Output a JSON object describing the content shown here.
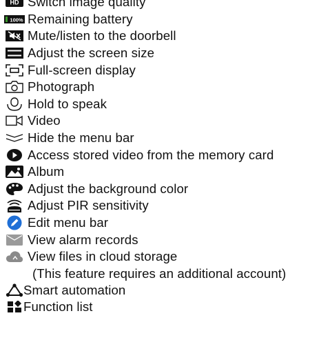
{
  "legend": {
    "items": [
      {
        "icon": "hd-icon",
        "label": "Switch image quality"
      },
      {
        "icon": "battery-icon",
        "badge": "100%",
        "label": "Remaining battery"
      },
      {
        "icon": "mute-icon",
        "label": "Mute/listen to the doorbell"
      },
      {
        "icon": "screen-size-icon",
        "label": "Adjust the screen size"
      },
      {
        "icon": "fullscreen-icon",
        "label": "Full-screen display"
      },
      {
        "icon": "camera-icon",
        "label": "Photograph"
      },
      {
        "icon": "speak-icon",
        "label": "Hold to speak"
      },
      {
        "icon": "video-icon",
        "label": "Video"
      },
      {
        "icon": "chevron-double-down-icon",
        "label": "Hide the menu bar"
      },
      {
        "icon": "playback-icon",
        "label": "Access stored video from the memory card"
      },
      {
        "icon": "album-icon",
        "label": "Album"
      },
      {
        "icon": "palette-icon",
        "label": "Adjust the background color"
      },
      {
        "icon": "pir-sensor-icon",
        "label": "Adjust PIR sensitivity"
      },
      {
        "icon": "edit-icon",
        "label": "Edit menu bar"
      },
      {
        "icon": "mail-icon",
        "label": "View alarm records"
      },
      {
        "icon": "cloud-icon",
        "label": "View files in cloud storage"
      },
      {
        "icon": "",
        "label": "(This feature requires an additional account)"
      },
      {
        "icon": "automation-icon",
        "label": "Smart automation"
      },
      {
        "icon": "function-list-icon",
        "label": "Function list"
      }
    ]
  },
  "colors": {
    "text": "#111111",
    "icon_dark": "#111111",
    "battery_green": "#3a9a2a",
    "edit_blue": "#1f6fd6",
    "mail_gray": "#9a9a9a",
    "cloud_gray": "#8a8a8a"
  }
}
